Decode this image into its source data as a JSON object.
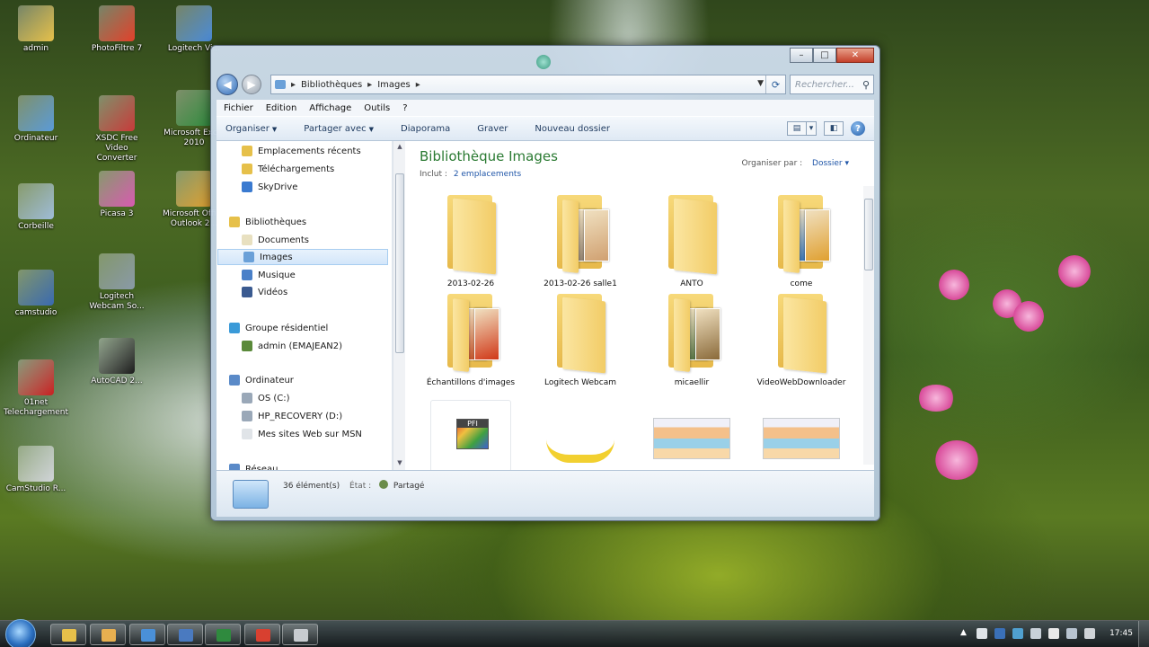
{
  "desktop": {
    "icons": [
      {
        "label": "admin",
        "icon": "user-folder-icon",
        "color": "#e6c04a"
      },
      {
        "label": "PhotoFiltre 7",
        "icon": "photofiltre-icon",
        "color": "#e2402a"
      },
      {
        "label": "Logitech Vi...",
        "icon": "logitech-icon",
        "color": "#4a8ad8"
      },
      {
        "label": "Ordinateur",
        "icon": "computer-icon",
        "color": "#5a9ad8"
      },
      {
        "label": "XSDC Free Video Converter",
        "icon": "video-converter-icon",
        "color": "#c83a3a"
      },
      {
        "label": "Microsoft Excel 2010",
        "icon": "excel-icon",
        "color": "#2f8a3e"
      },
      {
        "label": "Corbeille",
        "icon": "recycle-bin-icon",
        "color": "#9fbcd8"
      },
      {
        "label": "Picasa 3",
        "icon": "picasa-icon",
        "color": "#d85ab0"
      },
      {
        "label": "Microsoft Office Outlook 2...",
        "icon": "outlook-icon",
        "color": "#e0a030"
      },
      {
        "label": "camstudio",
        "icon": "camstudio-icon",
        "color": "#3a6ab0"
      },
      {
        "label": "Logitech Webcam So...",
        "icon": "webcam-icon",
        "color": "#8a9aa8"
      },
      {
        "label": "01net Telechargement",
        "icon": "01net-icon",
        "color": "#c82020"
      },
      {
        "label": "AutoCAD 2...",
        "icon": "autocad-icon",
        "color": "#1a1a1a"
      },
      {
        "label": "CamStudio R...",
        "icon": "camstudio-recorder-icon",
        "color": "#d0d4d8"
      }
    ]
  },
  "window": {
    "address": {
      "segments": [
        "Bibliothèques",
        "Images"
      ],
      "separator": "▸"
    },
    "search_placeholder": "Rechercher...",
    "menu": [
      "Fichier",
      "Edition",
      "Affichage",
      "Outils",
      "?"
    ],
    "commands": [
      "Organiser",
      "Partager avec",
      "Diaporama",
      "Graver",
      "Nouveau dossier"
    ],
    "nav": {
      "items": [
        {
          "label": "Emplacements récents",
          "icon": "recent-places-icon",
          "color": "#e6c04a"
        },
        {
          "label": "Téléchargements",
          "icon": "downloads-icon",
          "color": "#e6c04a"
        },
        {
          "label": "SkyDrive",
          "icon": "skydrive-icon",
          "color": "#3a7ad0"
        },
        {
          "label": "Bibliothèques",
          "icon": "libraries-icon",
          "color": "#e6c04a"
        },
        {
          "label": "Documents",
          "icon": "documents-icon",
          "color": "#e8e0c0"
        },
        {
          "label": "Images",
          "icon": "images-icon",
          "color": "#6aa0d8",
          "selected": true
        },
        {
          "label": "Musique",
          "icon": "music-icon",
          "color": "#4a80c8"
        },
        {
          "label": "Vidéos",
          "icon": "videos-icon",
          "color": "#3a5a90"
        },
        {
          "label": "Groupe résidentiel",
          "icon": "homegroup-icon",
          "color": "#3a9ad8"
        },
        {
          "label": "admin (EMAJEAN2)",
          "icon": "user-icon",
          "color": "#5a8a3a"
        },
        {
          "label": "Ordinateur",
          "icon": "computer-icon",
          "color": "#5a8ac8"
        },
        {
          "label": "OS (C:)",
          "icon": "drive-c-icon",
          "color": "#9aa8b8"
        },
        {
          "label": "HP_RECOVERY (D:)",
          "icon": "drive-d-icon",
          "color": "#9aa8b8"
        },
        {
          "label": "Mes sites Web sur MSN",
          "icon": "msn-sites-icon",
          "color": "#e0e4e8"
        },
        {
          "label": "Réseau",
          "icon": "network-icon",
          "color": "#5a8ac8"
        }
      ]
    },
    "library": {
      "title": "Bibliothèque Images",
      "included_label": "Inclut :",
      "included_link": "2 emplacements",
      "arrange_label": "Organiser par :",
      "arrange_value": "Dossier"
    },
    "files": [
      {
        "name": "2013-02-26",
        "type": "folder"
      },
      {
        "name": "2013-02-26 salle1",
        "type": "folder",
        "pics": [
          "#8a7a6a",
          "#d0a070"
        ]
      },
      {
        "name": "ANTO",
        "type": "folder"
      },
      {
        "name": "come",
        "type": "folder",
        "pics": [
          "#2a6ab0",
          "#e0a030"
        ]
      },
      {
        "name": "Échantillons d'images",
        "type": "folder",
        "pics": [
          "#c04a20",
          "#d03818"
        ]
      },
      {
        "name": "Logitech Webcam",
        "type": "folder"
      },
      {
        "name": "micaellir",
        "type": "folder",
        "pics": [
          "#4a6a3a",
          "#8a6a3a"
        ]
      },
      {
        "name": "VideoWebDownloader",
        "type": "folder"
      },
      {
        "name": "",
        "type": "file",
        "label": "PFI"
      },
      {
        "name": "",
        "type": "banana"
      },
      {
        "name": "",
        "type": "screenshot"
      },
      {
        "name": "",
        "type": "screenshot"
      }
    ],
    "status": {
      "count": "36 élément(s)",
      "state_label": "État :",
      "state_value": "Partagé"
    }
  },
  "taskbar": {
    "apps": [
      {
        "icon": "explorer-icon",
        "color": "#e6c04a"
      },
      {
        "icon": "folder-icon",
        "color": "#e8b050"
      },
      {
        "icon": "ie-icon",
        "color": "#4a90d8"
      },
      {
        "icon": "window-icon",
        "color": "#4a7ac0"
      },
      {
        "icon": "excel-icon",
        "color": "#2f8a3e"
      },
      {
        "icon": "photofiltre-icon",
        "color": "#d84030"
      },
      {
        "icon": "window2-icon",
        "color": "#c8ccd0"
      }
    ],
    "clock": "17:45"
  }
}
